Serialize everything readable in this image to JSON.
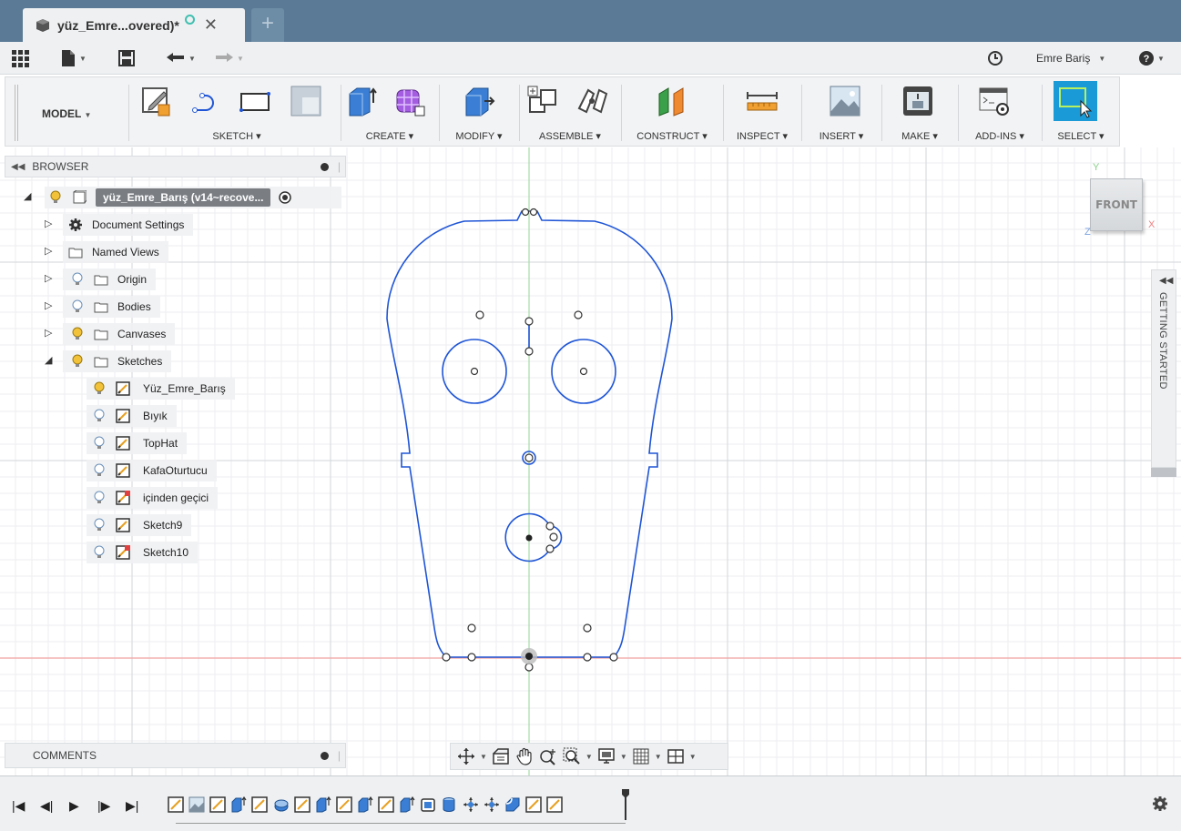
{
  "tab": {
    "title": "yüz_Emre...overed)*",
    "close": "✕",
    "new": "+"
  },
  "qat": {
    "user": "Emre Bariş"
  },
  "ribbon": {
    "mode": "MODEL",
    "groups": [
      "SKETCH",
      "CREATE",
      "MODIFY",
      "ASSEMBLE",
      "CONSTRUCT",
      "INSPECT",
      "INSERT",
      "MAKE",
      "ADD-INS",
      "SELECT"
    ]
  },
  "browser": {
    "title": "BROWSER",
    "root": "yüz_Emre_Barış (v14~recove...",
    "items": [
      "Document Settings",
      "Named Views",
      "Origin",
      "Bodies",
      "Canvases",
      "Sketches"
    ],
    "sketches": [
      "Yüz_Emre_Barış",
      "Bıyık",
      "TopHat",
      "KafaOturtucu",
      "içinden geçici",
      "Sketch9",
      "Sketch10"
    ]
  },
  "viewcube": {
    "face": "FRONT",
    "axis_y": "Y",
    "axis_x": "X",
    "axis_z": "Z"
  },
  "getting_started": "GETTING STARTED",
  "comments": {
    "title": "COMMENTS"
  },
  "colors": {
    "sketch": "#1f55d6",
    "accent": "#1a9ad6",
    "titlebar": "#5a7a96",
    "x_axis": "#f08080",
    "y_axis": "#80d080"
  }
}
